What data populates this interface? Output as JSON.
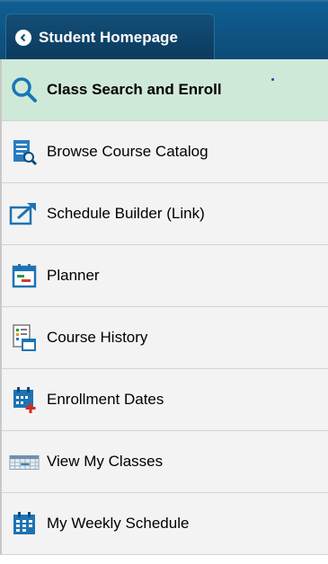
{
  "header": {
    "back_label": "Student Homepage"
  },
  "nav": {
    "items": [
      {
        "label": "Class Search and Enroll",
        "icon": "magnifier-icon",
        "active": true
      },
      {
        "label": "Browse Course Catalog",
        "icon": "catalog-search-icon"
      },
      {
        "label": "Schedule Builder (Link)",
        "icon": "external-link-icon"
      },
      {
        "label": "Planner",
        "icon": "planner-icon"
      },
      {
        "label": "Course History",
        "icon": "course-history-icon"
      },
      {
        "label": "Enrollment Dates",
        "icon": "calendar-add-icon"
      },
      {
        "label": "View My Classes",
        "icon": "class-schedule-icon"
      },
      {
        "label": "My Weekly Schedule",
        "icon": "weekly-calendar-icon"
      }
    ]
  },
  "colors": {
    "header_blue": "#0d4b77",
    "active_bg": "#cfe9d8",
    "icon_blue": "#1a7fc1"
  }
}
